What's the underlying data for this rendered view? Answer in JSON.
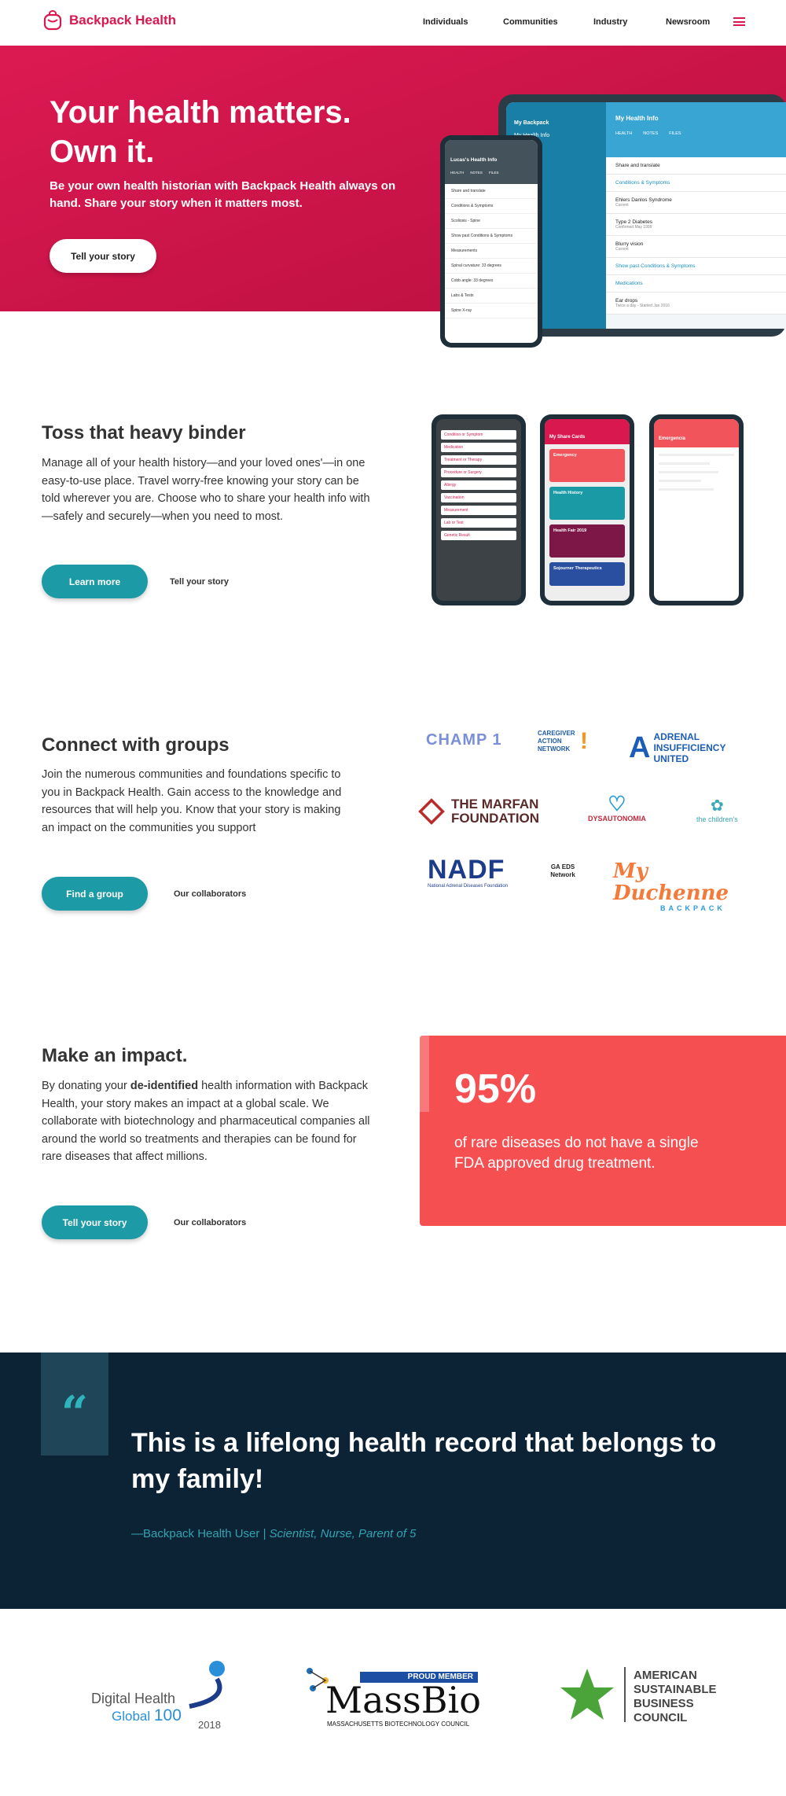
{
  "nav": {
    "brand": "Backpack Health",
    "links": [
      "Individuals",
      "Communities",
      "Industry",
      "Newsroom"
    ]
  },
  "hero": {
    "title": "Your health matters. Own it.",
    "subtitle": "Be your own health historian with Backpack Health always on hand. Share your story when it matters most.",
    "cta": "Tell your story"
  },
  "hero_phone": {
    "title": "Lucas's Health Info",
    "tabs": [
      "HEALTH",
      "NOTES",
      "FILES"
    ],
    "rows": [
      "Share and translate",
      "Conditions & Symptoms",
      "Scoliosis - Spine",
      "Show past Conditions & Symptoms",
      "Measurements",
      "Spinal curvature: 33 degrees",
      "Cobb angle: 33 degrees",
      "Labs & Tests",
      "Spine X-ray"
    ]
  },
  "hero_tablet": {
    "sidebar": [
      "My Backpack",
      "My Health Info"
    ],
    "title": "My Health Info",
    "tabs": [
      "HEALTH",
      "NOTES",
      "FILES"
    ],
    "rows": [
      {
        "label": "Share and translate",
        "sub": ""
      },
      {
        "label": "Conditions & Symptoms",
        "sub": ""
      },
      {
        "label": "Ehlers Danlos Syndrome",
        "sub": "Current"
      },
      {
        "label": "Type 2 Diabetes",
        "sub": "Confirmed May 1999"
      },
      {
        "label": "Blurry vision",
        "sub": "Current"
      },
      {
        "label": "Show past Conditions & Symptoms",
        "sub": ""
      },
      {
        "label": "Medications",
        "sub": ""
      },
      {
        "label": "Ear drops",
        "sub": "Twice a day - Started Jan 2016"
      }
    ]
  },
  "binder": {
    "title": "Toss that heavy binder",
    "body": "Manage all of your health history—and your loved ones'—in one easy-to-use place. Travel worry-free knowing your story can be told wherever you are. Choose who to share your health info with—safely and securely—when you need to most.",
    "cta_primary": "Learn more",
    "cta_secondary": "Tell your story"
  },
  "binder_phone_list": [
    "Condition or Symptom",
    "Medication",
    "Treatment or Therapy",
    "Procedure or Surgery",
    "Allergy",
    "Vaccination",
    "Measurement",
    "Lab or Test",
    "Genetic Result"
  ],
  "share_cards": {
    "title": "My Share Cards",
    "cards": [
      "Emergency",
      "Health History",
      "Health Fair 2019",
      "Sojourner Therapeutics"
    ],
    "colors": [
      "#f2545b",
      "#1a9aa4",
      "#7c1748",
      "#2a4fa0"
    ]
  },
  "emergency_card": {
    "title": "Emergencia"
  },
  "groups": {
    "title": "Connect with groups",
    "body": "Join the numerous communities and foundations specific to you in Backpack Health. Gain access to the knowledge and resources that will help you. Know that your story is making an impact on the communities you support",
    "cta_primary": "Find a group",
    "cta_secondary": "Our collaborators",
    "logos": [
      "CHAMP 1",
      "CAREGIVER ACTION NETWORK",
      "ADRENAL INSUFFICIENCY UNITED",
      "THE MARFAN FOUNDATION",
      "DYSAUTONOMIA",
      "the children's",
      "NADF",
      "National Adrenal Diseases Foundation",
      "GA EDS Network",
      "My Duchenne",
      "BACKPACK"
    ]
  },
  "impact": {
    "title": "Make an impact.",
    "body_pre": "By donating your ",
    "body_bold": "de-identified",
    "body_post": " health information with Backpack Health, your story makes an impact at a global scale. We collaborate with biotechnology and pharmaceutical companies all around the world so treatments and therapies can be found for rare diseases that affect millions.",
    "cta_primary": "Tell your story",
    "cta_secondary": "Our collaborators",
    "stat_value": "95%",
    "stat_text": "of rare diseases do not have a single FDA approved drug treatment."
  },
  "quote": {
    "mark": "“",
    "text": "This is a lifelong health record that belongs to my family!",
    "attribution": "—Backpack Health User | ",
    "attribution_italic": "Scientist, Nurse, Parent of 5"
  },
  "awards": {
    "dhg_line1": "Digital Health",
    "dhg_line2": "Global",
    "dhg_num": "100",
    "dhg_year": "2018",
    "massbio_badge": "PROUD MEMBER",
    "massbio_name": "MassBio",
    "massbio_sub": "Massachusetts Biotechnology Council",
    "asbc": [
      "American",
      "Sustainable",
      "Business",
      "Council"
    ]
  },
  "colors": {
    "brand": "#d9184f",
    "teal": "#1c9aa6",
    "coral": "#f54f52",
    "navy": "#0c2336"
  }
}
